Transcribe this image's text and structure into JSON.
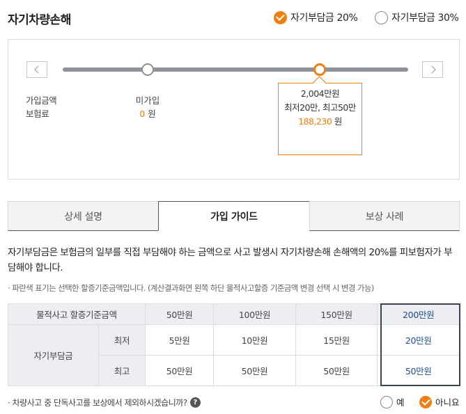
{
  "header": {
    "title": "자기차량손해",
    "ratio_options": [
      {
        "label": "자기부담금 20%",
        "selected": true
      },
      {
        "label": "자기부담금 30%",
        "selected": false
      }
    ]
  },
  "slider": {
    "row_labels": [
      "가입금액",
      "보험료"
    ],
    "not_enrolled": {
      "label": "미가입",
      "premium": "0",
      "unit": "원"
    },
    "selected": {
      "amount": "2,004만원",
      "range": "최저20만, 최고50만",
      "premium": "188,230",
      "unit": "원"
    }
  },
  "tabs": [
    "상세 설명",
    "가입 가이드",
    "보상 사례"
  ],
  "active_tab": 1,
  "guide": {
    "description": "자기부담금은 보험금의 일부를 직접 부담해야 하는 금액으로 사고 발생시 자기차량손해 손해액의 20%를 피보험자가 부담해야 합니다.",
    "note": "· 파란색 표기는 선택한 할증기준금액입니다. (계산결과화면 왼쪽 하단 물적사고할증 기준금액 변경 선택 시 변경 가능)",
    "table": {
      "header_label": "물적사고 할증기준금액",
      "columns": [
        "50만원",
        "100만원",
        "150만원",
        "200만원"
      ],
      "row_group": "자기부담금",
      "rows": [
        {
          "label": "최저",
          "values": [
            "5만원",
            "10만원",
            "15만원",
            "20만원"
          ]
        },
        {
          "label": "최고",
          "values": [
            "50만원",
            "50만원",
            "50만원",
            "50만원"
          ]
        }
      ]
    }
  },
  "question": {
    "text": "· 차량사고 중 단독사고를 보상에서 제외하시겠습니까?",
    "help_icon": "?",
    "options": [
      {
        "label": "예",
        "selected": false
      },
      {
        "label": "아니요",
        "selected": true
      }
    ]
  },
  "colors": {
    "accent": "#f07e11",
    "selected_column": "#1b4c9a",
    "track": "#8e939b"
  }
}
